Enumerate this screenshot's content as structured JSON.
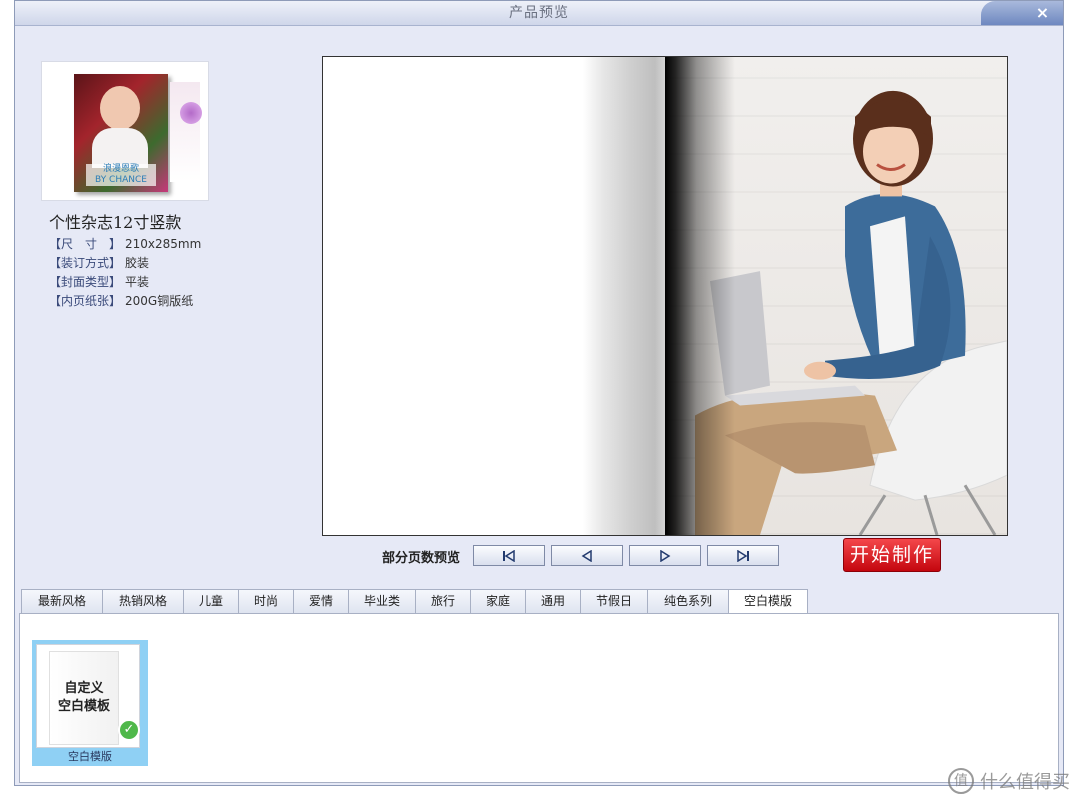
{
  "window": {
    "title": "产品预览",
    "close_label": "×"
  },
  "product": {
    "name": "个性杂志12寸竖款",
    "cover_text": "浪漫恩歌\nBY CHANCE",
    "specs": [
      {
        "key": "【尺　寸　】",
        "value": "210x285mm"
      },
      {
        "key": "【装订方式】",
        "value": "胶装"
      },
      {
        "key": "【封面类型】",
        "value": "平装"
      },
      {
        "key": "【内页纸张】",
        "value": "200G铜版纸"
      }
    ]
  },
  "navigation": {
    "label": "部分页数预览",
    "buttons": [
      {
        "name": "first-page-button",
        "icon": "skip-first-icon"
      },
      {
        "name": "prev-page-button",
        "icon": "prev-icon"
      },
      {
        "name": "next-page-button",
        "icon": "next-icon"
      },
      {
        "name": "last-page-button",
        "icon": "skip-last-icon"
      }
    ],
    "start_label": "开始制作"
  },
  "tabs": [
    {
      "label": "最新风格",
      "width": 82
    },
    {
      "label": "热销风格",
      "width": 82
    },
    {
      "label": "儿童",
      "width": 56
    },
    {
      "label": "时尚",
      "width": 56
    },
    {
      "label": "爱情",
      "width": 56
    },
    {
      "label": "毕业类",
      "width": 68
    },
    {
      "label": "旅行",
      "width": 56
    },
    {
      "label": "家庭",
      "width": 56
    },
    {
      "label": "通用",
      "width": 56
    },
    {
      "label": "节假日",
      "width": 68
    },
    {
      "label": "纯色系列",
      "width": 82
    },
    {
      "label": "空白模版",
      "width": 80,
      "active": true
    }
  ],
  "templates": [
    {
      "title": "自定义\n空白模板",
      "caption": "空白模版",
      "selected": true
    }
  ],
  "watermark": {
    "text": "什么值得买",
    "icon": "值"
  },
  "colors": {
    "accent": "#d0121a",
    "selection": "#8fd0f4",
    "window_bg": "#e6e9f6"
  }
}
